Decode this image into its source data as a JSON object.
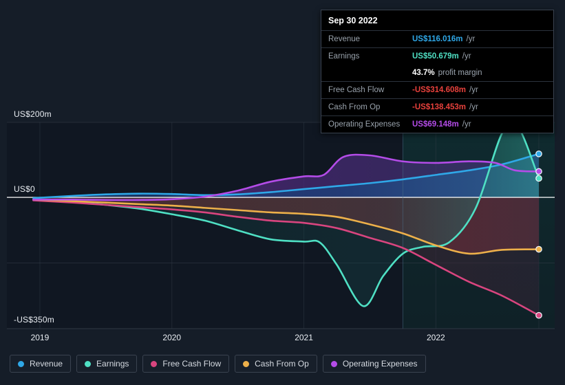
{
  "chart_data": {
    "type": "area",
    "title": "",
    "xlabel": "",
    "ylabel": "",
    "ylim": [
      -350,
      200
    ],
    "xlim": [
      2018.75,
      2022.9
    ],
    "y_ticks": [
      {
        "value": 200,
        "label": "US$200m"
      },
      {
        "value": 0,
        "label": "US$0"
      },
      {
        "value": -175,
        "label": ""
      },
      {
        "value": -350,
        "label": "-US$350m"
      }
    ],
    "x_ticks": [
      {
        "value": 2019,
        "label": "2019"
      },
      {
        "value": 2020,
        "label": "2020"
      },
      {
        "value": 2021,
        "label": "2021"
      },
      {
        "value": 2022,
        "label": "2022"
      },
      {
        "value": 2022.78,
        "label": ""
      }
    ],
    "grid": true,
    "legend_position": "bottom",
    "forecast_boundary": 2021.75,
    "currency": "US$",
    "units": "m",
    "series": [
      {
        "name": "Revenue",
        "color": "#2fa8e8",
        "end_value": 116.016,
        "x": [
          2018.95,
          2019.25,
          2019.5,
          2019.75,
          2020.0,
          2020.25,
          2020.5,
          2020.75,
          2021.0,
          2021.25,
          2021.5,
          2021.75,
          2022.0,
          2022.25,
          2022.5,
          2022.78
        ],
        "values": [
          -2,
          4,
          8,
          10,
          9,
          6,
          8,
          14,
          22,
          30,
          38,
          48,
          60,
          72,
          88,
          116.016
        ]
      },
      {
        "name": "Earnings",
        "color": "#4fe0c4",
        "end_value": 50.679,
        "x": [
          2018.95,
          2019.25,
          2019.5,
          2019.75,
          2020.0,
          2020.25,
          2020.5,
          2020.75,
          2021.0,
          2021.12,
          2021.25,
          2021.45,
          2021.6,
          2021.75,
          2021.9,
          2022.1,
          2022.3,
          2022.5,
          2022.62,
          2022.78
        ],
        "values": [
          -6,
          -12,
          -20,
          -30,
          -45,
          -62,
          -88,
          -112,
          -118,
          -120,
          -180,
          -290,
          -210,
          -150,
          -132,
          -120,
          -30,
          170,
          190,
          50.679
        ]
      },
      {
        "name": "Free Cash Flow",
        "color": "#d9457f",
        "end_value": -314.608,
        "x": [
          2018.95,
          2019.25,
          2019.5,
          2019.75,
          2020.0,
          2020.25,
          2020.5,
          2020.75,
          2021.0,
          2021.25,
          2021.5,
          2021.75,
          2022.0,
          2022.25,
          2022.5,
          2022.78
        ],
        "values": [
          -8,
          -14,
          -20,
          -26,
          -32,
          -40,
          -52,
          -62,
          -68,
          -82,
          -108,
          -135,
          -180,
          -225,
          -262,
          -314.608
        ]
      },
      {
        "name": "Cash From Op",
        "color": "#edb04a",
        "end_value": -138.453,
        "x": [
          2018.95,
          2019.25,
          2019.5,
          2019.75,
          2020.0,
          2020.25,
          2020.5,
          2020.75,
          2021.0,
          2021.25,
          2021.5,
          2021.75,
          2022.0,
          2022.25,
          2022.5,
          2022.78
        ],
        "values": [
          -6,
          -10,
          -14,
          -18,
          -22,
          -28,
          -34,
          -40,
          -44,
          -52,
          -72,
          -96,
          -128,
          -150,
          -140,
          -138.453
        ]
      },
      {
        "name": "Operating Expenses",
        "color": "#b44ce8",
        "end_value": 69.148,
        "x": [
          2018.95,
          2019.25,
          2019.5,
          2019.75,
          2020.0,
          2020.25,
          2020.5,
          2020.75,
          2021.0,
          2021.15,
          2021.3,
          2021.5,
          2021.75,
          2022.0,
          2022.25,
          2022.45,
          2022.6,
          2022.78
        ],
        "values": [
          -6,
          -6,
          -7,
          -7,
          -5,
          2,
          18,
          42,
          56,
          60,
          108,
          112,
          96,
          92,
          96,
          92,
          72,
          69.148
        ]
      }
    ]
  },
  "tooltip": {
    "title": "Sep 30 2022",
    "rows": [
      {
        "name": "Revenue",
        "value": "US$116.016m",
        "unit": "/yr",
        "color": "#2fa8e8"
      },
      {
        "name": "Earnings",
        "value": "US$50.679m",
        "unit": "/yr",
        "color": "#4fe0c4"
      },
      {
        "name": "",
        "value": "43.7%",
        "unit": "profit margin",
        "color": "#ffffff",
        "sub": true
      },
      {
        "name": "Free Cash Flow",
        "value": "-US$314.608m",
        "unit": "/yr",
        "color": "#e8413c"
      },
      {
        "name": "Cash From Op",
        "value": "-US$138.453m",
        "unit": "/yr",
        "color": "#e8413c"
      },
      {
        "name": "Operating Expenses",
        "value": "US$69.148m",
        "unit": "/yr",
        "color": "#b44ce8"
      }
    ]
  },
  "legend": {
    "items": [
      {
        "label": "Revenue",
        "color": "#2fa8e8"
      },
      {
        "label": "Earnings",
        "color": "#4fe0c4"
      },
      {
        "label": "Free Cash Flow",
        "color": "#d9457f"
      },
      {
        "label": "Cash From Op",
        "color": "#edb04a"
      },
      {
        "label": "Operating Expenses",
        "color": "#b44ce8"
      }
    ]
  },
  "theme": {
    "background": "#151d28",
    "plot_background": "#101722",
    "grid_color": "#343d49",
    "zero_line_color": "#ffffff",
    "text_color": "#e9edf2",
    "muted_text_color": "#9aa3ad"
  }
}
